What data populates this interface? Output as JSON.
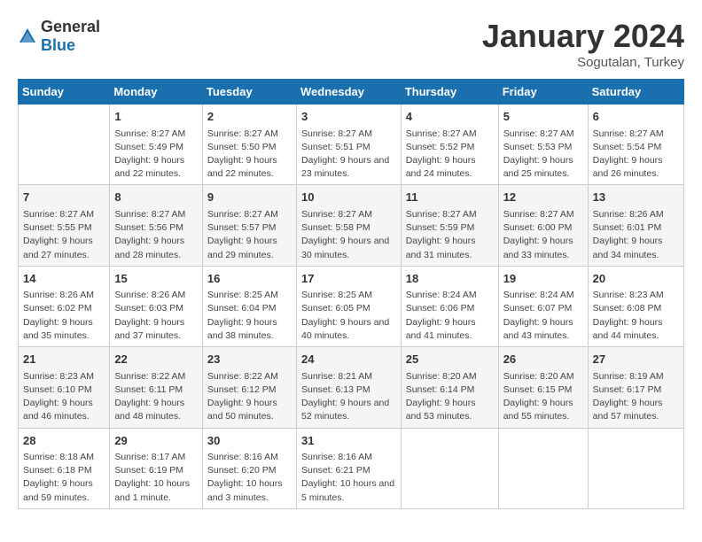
{
  "logo": {
    "general": "General",
    "blue": "Blue"
  },
  "header": {
    "month": "January 2024",
    "location": "Sogutalan, Turkey"
  },
  "weekdays": [
    "Sunday",
    "Monday",
    "Tuesday",
    "Wednesday",
    "Thursday",
    "Friday",
    "Saturday"
  ],
  "weeks": [
    [
      {
        "day": "",
        "sunrise": "",
        "sunset": "",
        "daylight": ""
      },
      {
        "day": "1",
        "sunrise": "Sunrise: 8:27 AM",
        "sunset": "Sunset: 5:49 PM",
        "daylight": "Daylight: 9 hours and 22 minutes."
      },
      {
        "day": "2",
        "sunrise": "Sunrise: 8:27 AM",
        "sunset": "Sunset: 5:50 PM",
        "daylight": "Daylight: 9 hours and 22 minutes."
      },
      {
        "day": "3",
        "sunrise": "Sunrise: 8:27 AM",
        "sunset": "Sunset: 5:51 PM",
        "daylight": "Daylight: 9 hours and 23 minutes."
      },
      {
        "day": "4",
        "sunrise": "Sunrise: 8:27 AM",
        "sunset": "Sunset: 5:52 PM",
        "daylight": "Daylight: 9 hours and 24 minutes."
      },
      {
        "day": "5",
        "sunrise": "Sunrise: 8:27 AM",
        "sunset": "Sunset: 5:53 PM",
        "daylight": "Daylight: 9 hours and 25 minutes."
      },
      {
        "day": "6",
        "sunrise": "Sunrise: 8:27 AM",
        "sunset": "Sunset: 5:54 PM",
        "daylight": "Daylight: 9 hours and 26 minutes."
      }
    ],
    [
      {
        "day": "7",
        "sunrise": "Sunrise: 8:27 AM",
        "sunset": "Sunset: 5:55 PM",
        "daylight": "Daylight: 9 hours and 27 minutes."
      },
      {
        "day": "8",
        "sunrise": "Sunrise: 8:27 AM",
        "sunset": "Sunset: 5:56 PM",
        "daylight": "Daylight: 9 hours and 28 minutes."
      },
      {
        "day": "9",
        "sunrise": "Sunrise: 8:27 AM",
        "sunset": "Sunset: 5:57 PM",
        "daylight": "Daylight: 9 hours and 29 minutes."
      },
      {
        "day": "10",
        "sunrise": "Sunrise: 8:27 AM",
        "sunset": "Sunset: 5:58 PM",
        "daylight": "Daylight: 9 hours and 30 minutes."
      },
      {
        "day": "11",
        "sunrise": "Sunrise: 8:27 AM",
        "sunset": "Sunset: 5:59 PM",
        "daylight": "Daylight: 9 hours and 31 minutes."
      },
      {
        "day": "12",
        "sunrise": "Sunrise: 8:27 AM",
        "sunset": "Sunset: 6:00 PM",
        "daylight": "Daylight: 9 hours and 33 minutes."
      },
      {
        "day": "13",
        "sunrise": "Sunrise: 8:26 AM",
        "sunset": "Sunset: 6:01 PM",
        "daylight": "Daylight: 9 hours and 34 minutes."
      }
    ],
    [
      {
        "day": "14",
        "sunrise": "Sunrise: 8:26 AM",
        "sunset": "Sunset: 6:02 PM",
        "daylight": "Daylight: 9 hours and 35 minutes."
      },
      {
        "day": "15",
        "sunrise": "Sunrise: 8:26 AM",
        "sunset": "Sunset: 6:03 PM",
        "daylight": "Daylight: 9 hours and 37 minutes."
      },
      {
        "day": "16",
        "sunrise": "Sunrise: 8:25 AM",
        "sunset": "Sunset: 6:04 PM",
        "daylight": "Daylight: 9 hours and 38 minutes."
      },
      {
        "day": "17",
        "sunrise": "Sunrise: 8:25 AM",
        "sunset": "Sunset: 6:05 PM",
        "daylight": "Daylight: 9 hours and 40 minutes."
      },
      {
        "day": "18",
        "sunrise": "Sunrise: 8:24 AM",
        "sunset": "Sunset: 6:06 PM",
        "daylight": "Daylight: 9 hours and 41 minutes."
      },
      {
        "day": "19",
        "sunrise": "Sunrise: 8:24 AM",
        "sunset": "Sunset: 6:07 PM",
        "daylight": "Daylight: 9 hours and 43 minutes."
      },
      {
        "day": "20",
        "sunrise": "Sunrise: 8:23 AM",
        "sunset": "Sunset: 6:08 PM",
        "daylight": "Daylight: 9 hours and 44 minutes."
      }
    ],
    [
      {
        "day": "21",
        "sunrise": "Sunrise: 8:23 AM",
        "sunset": "Sunset: 6:10 PM",
        "daylight": "Daylight: 9 hours and 46 minutes."
      },
      {
        "day": "22",
        "sunrise": "Sunrise: 8:22 AM",
        "sunset": "Sunset: 6:11 PM",
        "daylight": "Daylight: 9 hours and 48 minutes."
      },
      {
        "day": "23",
        "sunrise": "Sunrise: 8:22 AM",
        "sunset": "Sunset: 6:12 PM",
        "daylight": "Daylight: 9 hours and 50 minutes."
      },
      {
        "day": "24",
        "sunrise": "Sunrise: 8:21 AM",
        "sunset": "Sunset: 6:13 PM",
        "daylight": "Daylight: 9 hours and 52 minutes."
      },
      {
        "day": "25",
        "sunrise": "Sunrise: 8:20 AM",
        "sunset": "Sunset: 6:14 PM",
        "daylight": "Daylight: 9 hours and 53 minutes."
      },
      {
        "day": "26",
        "sunrise": "Sunrise: 8:20 AM",
        "sunset": "Sunset: 6:15 PM",
        "daylight": "Daylight: 9 hours and 55 minutes."
      },
      {
        "day": "27",
        "sunrise": "Sunrise: 8:19 AM",
        "sunset": "Sunset: 6:17 PM",
        "daylight": "Daylight: 9 hours and 57 minutes."
      }
    ],
    [
      {
        "day": "28",
        "sunrise": "Sunrise: 8:18 AM",
        "sunset": "Sunset: 6:18 PM",
        "daylight": "Daylight: 9 hours and 59 minutes."
      },
      {
        "day": "29",
        "sunrise": "Sunrise: 8:17 AM",
        "sunset": "Sunset: 6:19 PM",
        "daylight": "Daylight: 10 hours and 1 minute."
      },
      {
        "day": "30",
        "sunrise": "Sunrise: 8:16 AM",
        "sunset": "Sunset: 6:20 PM",
        "daylight": "Daylight: 10 hours and 3 minutes."
      },
      {
        "day": "31",
        "sunrise": "Sunrise: 8:16 AM",
        "sunset": "Sunset: 6:21 PM",
        "daylight": "Daylight: 10 hours and 5 minutes."
      },
      {
        "day": "",
        "sunrise": "",
        "sunset": "",
        "daylight": ""
      },
      {
        "day": "",
        "sunrise": "",
        "sunset": "",
        "daylight": ""
      },
      {
        "day": "",
        "sunrise": "",
        "sunset": "",
        "daylight": ""
      }
    ]
  ]
}
